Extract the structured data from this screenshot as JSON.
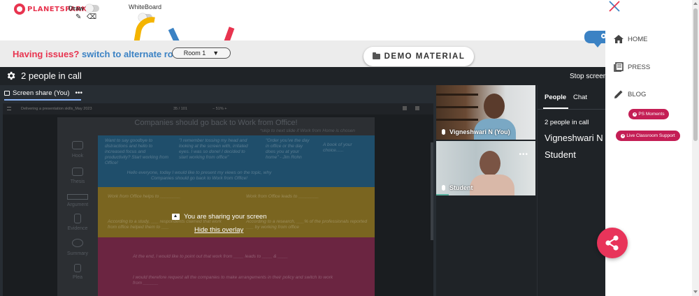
{
  "brand": {
    "logo_text": "PLANETSPARK"
  },
  "toolbar": {
    "draw_label": "Draw",
    "whiteboard_label": "WhiteBoard",
    "pencil_glyph": "✎",
    "eraser_glyph": "⌫"
  },
  "issues": {
    "question": "Having issues?",
    "link": "switch to alternate room",
    "room_value": "Room 1",
    "room_caret": "▼"
  },
  "demo_material": {
    "label": "DEMO MATERIAL"
  },
  "meet": {
    "header_title": "2 people in call",
    "stop_screen": "Stop screen",
    "share_tab_label": "Screen share (You)",
    "share_tab_menu": "•••",
    "viewer_title": "Delivering a presentation skills_May 2023",
    "viewer_pages": "35 / 101",
    "viewer_zoom": "− 51% +",
    "overlay_message": "You are sharing your screen",
    "overlay_hide": "Hide this overlay"
  },
  "slide": {
    "title": "Companies should go back to Work from Office!",
    "skip_note": "*skip to next slide if Work from Home is chosen",
    "categories": [
      "Hook",
      "Thesis",
      "Argument",
      "Evidence",
      "Summary",
      "Plea"
    ],
    "blue_texts": [
      "Want to say goodbye to distractions and hello to increased focus and productivity? Start working from Office!",
      "\"I remember tossing my head and looking at the screen with, irritated eyes. I was so done! I decided to start working from office\"",
      "\"Order you've the day in office or the day does you at your home\" - Jim Rohn",
      "A book of your choice......"
    ],
    "blue_intro": "Hello everyone, today I would like to present my views on the topic, why Companies should go back to Work from Office!",
    "yellow_texts": [
      "Work from Office helps to ________",
      "Work from Office leads to ________",
      "According to a study, ___ respondents claimed that work from office helped them to ___",
      "According to a research, ___% of the professionals reported ___ by working from office"
    ],
    "pink_texts": [
      "At the end, I would like to point out that work from ____ leads to ____ & ____",
      "I would therefore request all the companies to make arrangements in their policy and switch to work from ______"
    ]
  },
  "participants": [
    {
      "name": "Vigneshwari N (You)"
    },
    {
      "name": "Student"
    }
  ],
  "people_panel": {
    "tab_people": "People",
    "tab_chat": "Chat",
    "count": "2 people in call",
    "names": [
      "Vigneshwari N (",
      "Student"
    ]
  },
  "sidebar": {
    "items": [
      {
        "label": "HOME",
        "icon": "home-icon"
      },
      {
        "label": "PRESS",
        "icon": "press-icon"
      },
      {
        "label": "BLOG",
        "icon": "pencil-icon"
      }
    ],
    "pills": [
      "PS Moments",
      "Live Classroom Support"
    ]
  },
  "colors": {
    "brand_red": "#e8344f",
    "brand_blue": "#3b82c4",
    "meet_bg": "#1f2327",
    "pill_bg": "#c41e55",
    "fab_bg": "#e8345a"
  }
}
